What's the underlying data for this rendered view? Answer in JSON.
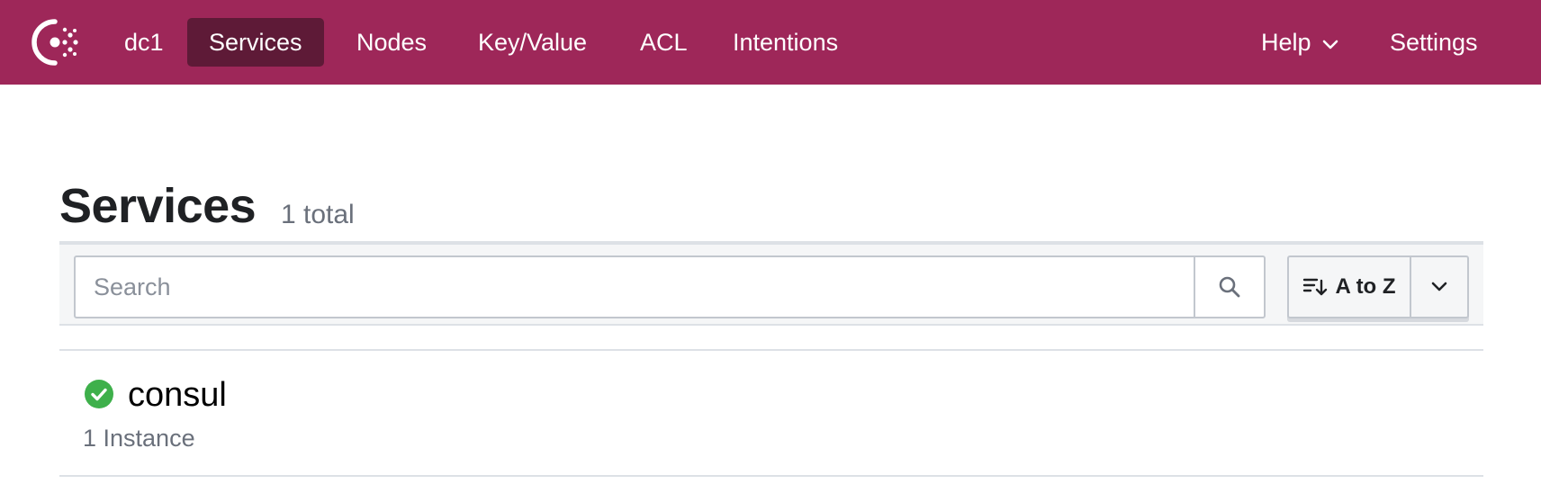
{
  "nav": {
    "logo_icon": "consul-logo-icon",
    "datacenter": "dc1",
    "items": [
      {
        "label": "Services",
        "active": true
      },
      {
        "label": "Nodes",
        "active": false
      },
      {
        "label": "Key/Value",
        "active": false
      },
      {
        "label": "ACL",
        "active": false
      },
      {
        "label": "Intentions",
        "active": false
      }
    ],
    "help": "Help",
    "settings": "Settings",
    "brand_color": "#9e2759",
    "active_color": "#5e1a37"
  },
  "page": {
    "title": "Services",
    "count": "1 total"
  },
  "search": {
    "placeholder": "Search",
    "value": ""
  },
  "sort": {
    "label": "A to Z"
  },
  "services": [
    {
      "name": "consul",
      "instances": "1 Instance",
      "status": "passing",
      "status_color": "#3eb04b"
    }
  ]
}
